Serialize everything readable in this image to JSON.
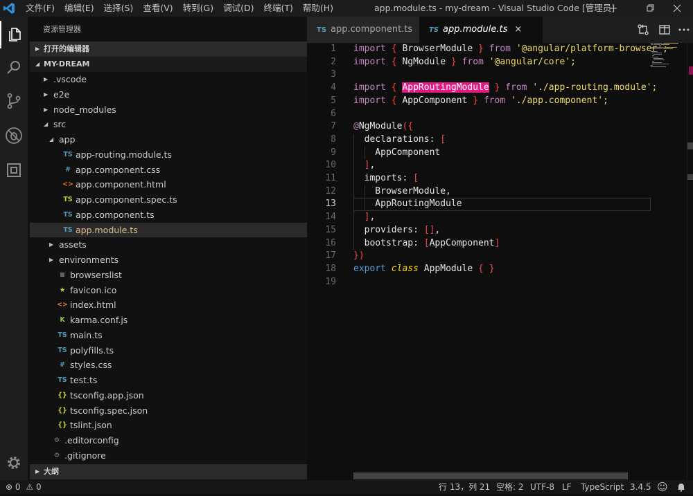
{
  "titlebar": {
    "menu": [
      "文件(F)",
      "编辑(E)",
      "选择(S)",
      "查看(V)",
      "转到(G)",
      "调试(D)",
      "终端(T)",
      "帮助(H)"
    ],
    "window_title": "app.module.ts - my-dream - Visual Studio Code [管理员]",
    "icons": [
      "vscode-logo-icon",
      "minimize-icon",
      "restore-icon",
      "close-icon"
    ]
  },
  "activitybar": {
    "items": [
      "explorer-icon",
      "search-icon",
      "source-control-icon",
      "debug-icon",
      "extensions-icon"
    ],
    "bottom": "settings-gear-icon"
  },
  "sidebar": {
    "title": "资源管理器",
    "open_editors": "打开的编辑器",
    "project": "MY-DREAM",
    "outline": "大纲",
    "tree": [
      {
        "name": ".vscode",
        "kind": "folder",
        "depth": 0,
        "open": false
      },
      {
        "name": "e2e",
        "kind": "folder",
        "depth": 0,
        "open": false
      },
      {
        "name": "node_modules",
        "kind": "folder",
        "depth": 0,
        "open": false
      },
      {
        "name": "src",
        "kind": "folder",
        "depth": 0,
        "open": true
      },
      {
        "name": "app",
        "kind": "folder",
        "depth": 1,
        "open": true
      },
      {
        "name": "app-routing.module.ts",
        "kind": "ts",
        "depth": 2
      },
      {
        "name": "app.component.css",
        "kind": "css",
        "depth": 2
      },
      {
        "name": "app.component.html",
        "kind": "html",
        "depth": 2
      },
      {
        "name": "app.component.spec.ts",
        "kind": "spec",
        "depth": 2
      },
      {
        "name": "app.component.ts",
        "kind": "ts",
        "depth": 2
      },
      {
        "name": "app.module.ts",
        "kind": "ts",
        "depth": 2,
        "selected": true
      },
      {
        "name": "assets",
        "kind": "folder",
        "depth": 1,
        "open": false
      },
      {
        "name": "environments",
        "kind": "folder",
        "depth": 1,
        "open": false
      },
      {
        "name": "browserslist",
        "kind": "txt",
        "depth": 1
      },
      {
        "name": "favicon.ico",
        "kind": "fav",
        "depth": 1
      },
      {
        "name": "index.html",
        "kind": "html",
        "depth": 1
      },
      {
        "name": "karma.conf.js",
        "kind": "karma",
        "depth": 1
      },
      {
        "name": "main.ts",
        "kind": "ts",
        "depth": 1
      },
      {
        "name": "polyfills.ts",
        "kind": "ts",
        "depth": 1
      },
      {
        "name": "styles.css",
        "kind": "css",
        "depth": 1
      },
      {
        "name": "test.ts",
        "kind": "ts",
        "depth": 1
      },
      {
        "name": "tsconfig.app.json",
        "kind": "json",
        "depth": 1
      },
      {
        "name": "tsconfig.spec.json",
        "kind": "json",
        "depth": 1
      },
      {
        "name": "tslint.json",
        "kind": "json",
        "depth": 1
      },
      {
        "name": ".editorconfig",
        "kind": "cfg",
        "depth": 0
      },
      {
        "name": ".gitignore",
        "kind": "cfg",
        "depth": 0
      }
    ],
    "icon_glyphs": {
      "ts": "TS",
      "spec": "TS",
      "css": "#",
      "html": "<>",
      "json": "{}",
      "fav": "★",
      "karma": "K",
      "txt": "≡",
      "cfg": "⚙"
    }
  },
  "tabs": [
    {
      "icon": "TS",
      "label": "app.component.ts",
      "active": false
    },
    {
      "icon": "TS",
      "label": "app.module.ts",
      "active": true,
      "close": "×"
    }
  ],
  "tab_actions": [
    "open-changes-icon",
    "split-editor-icon",
    "more-actions-icon"
  ],
  "editor": {
    "current_line": 13,
    "highlight_word": "AppRoutingModule",
    "lines": [
      [
        [
          "k",
          "import"
        ],
        [
          "t",
          " "
        ],
        [
          "p",
          "{"
        ],
        [
          "t",
          " BrowserModule "
        ],
        [
          "p",
          "}"
        ],
        [
          "t",
          " "
        ],
        [
          "k",
          "from"
        ],
        [
          "t",
          " "
        ],
        [
          "s",
          "'@angular/platform-browser';"
        ]
      ],
      [
        [
          "k",
          "import"
        ],
        [
          "t",
          " "
        ],
        [
          "p",
          "{"
        ],
        [
          "t",
          " NgModule "
        ],
        [
          "p",
          "}"
        ],
        [
          "t",
          " "
        ],
        [
          "k",
          "from"
        ],
        [
          "t",
          " "
        ],
        [
          "s",
          "'@angular/core';"
        ]
      ],
      [],
      [
        [
          "k",
          "import"
        ],
        [
          "t",
          " "
        ],
        [
          "p",
          "{"
        ],
        [
          "t",
          " "
        ],
        [
          "hl",
          "AppRoutingModule"
        ],
        [
          "t",
          " "
        ],
        [
          "p",
          "}"
        ],
        [
          "t",
          " "
        ],
        [
          "k",
          "from"
        ],
        [
          "t",
          " "
        ],
        [
          "s",
          "'./app-routing.module';"
        ]
      ],
      [
        [
          "k",
          "import"
        ],
        [
          "t",
          " "
        ],
        [
          "p",
          "{"
        ],
        [
          "t",
          " AppComponent "
        ],
        [
          "p",
          "}"
        ],
        [
          "t",
          " "
        ],
        [
          "k",
          "from"
        ],
        [
          "t",
          " "
        ],
        [
          "s",
          "'./app.component';"
        ]
      ],
      [],
      [
        [
          "dec",
          "@"
        ],
        [
          "t",
          "NgModule"
        ],
        [
          "p",
          "("
        ],
        [
          "p",
          "{"
        ]
      ],
      [
        [
          "t",
          "  declarations: "
        ],
        [
          "p",
          "["
        ]
      ],
      [
        [
          "t",
          "    AppComponent"
        ]
      ],
      [
        [
          "t",
          "  "
        ],
        [
          "p",
          "]"
        ],
        [
          "t",
          ","
        ]
      ],
      [
        [
          "t",
          "  imports: "
        ],
        [
          "p",
          "["
        ]
      ],
      [
        [
          "t",
          "    BrowserModule,"
        ]
      ],
      [
        [
          "t",
          "    AppRoutingModule"
        ]
      ],
      [
        [
          "t",
          "  "
        ],
        [
          "p",
          "]"
        ],
        [
          "t",
          ","
        ]
      ],
      [
        [
          "t",
          "  providers: "
        ],
        [
          "p",
          "[]"
        ],
        [
          "t",
          ","
        ]
      ],
      [
        [
          "t",
          "  bootstrap: "
        ],
        [
          "p",
          "["
        ],
        [
          "t",
          "AppComponent"
        ],
        [
          "p",
          "]"
        ]
      ],
      [
        [
          "p",
          "}"
        ],
        [
          "p",
          ")"
        ]
      ],
      [
        [
          "b",
          "export"
        ],
        [
          "t",
          " "
        ],
        [
          "cls",
          "class"
        ],
        [
          "t",
          " AppModule "
        ],
        [
          "p",
          "{"
        ],
        [
          "t",
          " "
        ],
        [
          "p",
          "}"
        ]
      ],
      []
    ]
  },
  "statusbar": {
    "errors": "0",
    "warnings": "0",
    "position": "行 13，列 21",
    "spaces": "空格: 2",
    "encoding": "UTF-8",
    "eol": "LF",
    "language": "TypeScript",
    "version": "3.4.5"
  }
}
